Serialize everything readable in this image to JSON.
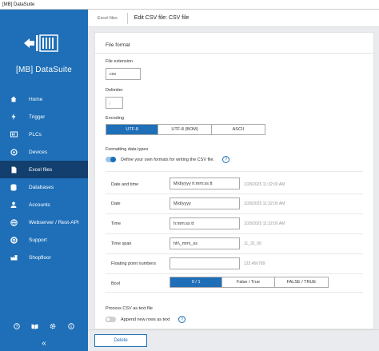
{
  "window": {
    "title": "[MB] DataSuite"
  },
  "sidebar": {
    "brand": "[MB] DataSuite",
    "items": [
      {
        "label": "Home",
        "icon": "home-icon",
        "active": false
      },
      {
        "label": "Trigger",
        "icon": "trigger-icon",
        "active": false
      },
      {
        "label": "PLCs",
        "icon": "plc-icon",
        "active": false
      },
      {
        "label": "Devices",
        "icon": "devices-icon",
        "active": false
      },
      {
        "label": "Excel files",
        "icon": "excel-file-icon",
        "active": true
      },
      {
        "label": "Databases",
        "icon": "database-icon",
        "active": false
      },
      {
        "label": "Accounts",
        "icon": "accounts-icon",
        "active": false
      },
      {
        "label": "Webserver / Rest-API",
        "icon": "webserver-icon",
        "active": false
      },
      {
        "label": "Support",
        "icon": "support-icon",
        "active": false
      },
      {
        "label": "Shopfloor",
        "icon": "shopfloor-icon",
        "active": false
      }
    ],
    "bottom_icons": [
      "help-icon",
      "book-icon",
      "gear-icon",
      "info-icon"
    ],
    "collapse_label": "«"
  },
  "breadcrumb": {
    "parent": "Excel files",
    "title": "Edit CSV file: CSV file"
  },
  "form": {
    "section_title": "File format",
    "extension_label": "File extension",
    "extension_value": "csv",
    "delimiter_label": "Delimiter",
    "delimiter_value": ";",
    "encoding_label": "Encoding",
    "encoding_options": [
      "UTF-8",
      "UTF-8 (BOM)",
      "ASCII"
    ],
    "formatting_label": "Formatting data types",
    "formatting_toggle_label": "Define your own formats for writing the CSV file.",
    "help_glyph": "?",
    "rows": [
      {
        "label": "Date and time",
        "value": "M/d/yyyy h:mm:ss tt",
        "sample": "1/28/2025 11:32:00 AM"
      },
      {
        "label": "Date",
        "value": "M/d/yyyy",
        "sample": "1/28/2025 11:32:00 AM"
      },
      {
        "label": "Time",
        "value": "h:mm:ss tt",
        "sample": "1/28/2025 11:32:00 AM"
      },
      {
        "label": "Time span",
        "value": "hh\\_mm\\_ss",
        "sample": "11_32_00"
      },
      {
        "label": "Floating point numbers",
        "value": "",
        "sample": "123.456789"
      }
    ],
    "bool_label": "Bool",
    "bool_options": [
      "0 / 1",
      "False / True",
      "FALSE / TRUE"
    ],
    "process_label": "Process CSV as text file",
    "append_label": "Append new rows as text"
  },
  "footer": {
    "delete_label": "Delete"
  },
  "colors": {
    "primary": "#1e6fb8",
    "sidebar_active": "#123f6d"
  }
}
